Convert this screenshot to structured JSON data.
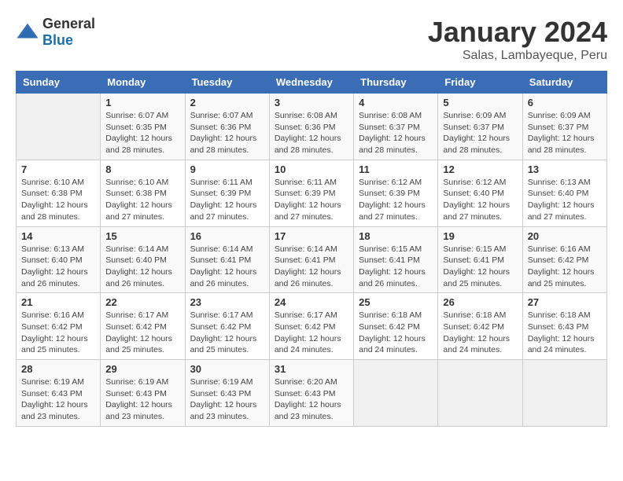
{
  "header": {
    "logo_general": "General",
    "logo_blue": "Blue",
    "month_year": "January 2024",
    "location": "Salas, Lambayeque, Peru"
  },
  "weekdays": [
    "Sunday",
    "Monday",
    "Tuesday",
    "Wednesday",
    "Thursday",
    "Friday",
    "Saturday"
  ],
  "weeks": [
    [
      {
        "day": "",
        "info": ""
      },
      {
        "day": "1",
        "info": "Sunrise: 6:07 AM\nSunset: 6:35 PM\nDaylight: 12 hours\nand 28 minutes."
      },
      {
        "day": "2",
        "info": "Sunrise: 6:07 AM\nSunset: 6:36 PM\nDaylight: 12 hours\nand 28 minutes."
      },
      {
        "day": "3",
        "info": "Sunrise: 6:08 AM\nSunset: 6:36 PM\nDaylight: 12 hours\nand 28 minutes."
      },
      {
        "day": "4",
        "info": "Sunrise: 6:08 AM\nSunset: 6:37 PM\nDaylight: 12 hours\nand 28 minutes."
      },
      {
        "day": "5",
        "info": "Sunrise: 6:09 AM\nSunset: 6:37 PM\nDaylight: 12 hours\nand 28 minutes."
      },
      {
        "day": "6",
        "info": "Sunrise: 6:09 AM\nSunset: 6:37 PM\nDaylight: 12 hours\nand 28 minutes."
      }
    ],
    [
      {
        "day": "7",
        "info": "Sunrise: 6:10 AM\nSunset: 6:38 PM\nDaylight: 12 hours\nand 28 minutes."
      },
      {
        "day": "8",
        "info": "Sunrise: 6:10 AM\nSunset: 6:38 PM\nDaylight: 12 hours\nand 27 minutes."
      },
      {
        "day": "9",
        "info": "Sunrise: 6:11 AM\nSunset: 6:39 PM\nDaylight: 12 hours\nand 27 minutes."
      },
      {
        "day": "10",
        "info": "Sunrise: 6:11 AM\nSunset: 6:39 PM\nDaylight: 12 hours\nand 27 minutes."
      },
      {
        "day": "11",
        "info": "Sunrise: 6:12 AM\nSunset: 6:39 PM\nDaylight: 12 hours\nand 27 minutes."
      },
      {
        "day": "12",
        "info": "Sunrise: 6:12 AM\nSunset: 6:40 PM\nDaylight: 12 hours\nand 27 minutes."
      },
      {
        "day": "13",
        "info": "Sunrise: 6:13 AM\nSunset: 6:40 PM\nDaylight: 12 hours\nand 27 minutes."
      }
    ],
    [
      {
        "day": "14",
        "info": "Sunrise: 6:13 AM\nSunset: 6:40 PM\nDaylight: 12 hours\nand 26 minutes."
      },
      {
        "day": "15",
        "info": "Sunrise: 6:14 AM\nSunset: 6:40 PM\nDaylight: 12 hours\nand 26 minutes."
      },
      {
        "day": "16",
        "info": "Sunrise: 6:14 AM\nSunset: 6:41 PM\nDaylight: 12 hours\nand 26 minutes."
      },
      {
        "day": "17",
        "info": "Sunrise: 6:14 AM\nSunset: 6:41 PM\nDaylight: 12 hours\nand 26 minutes."
      },
      {
        "day": "18",
        "info": "Sunrise: 6:15 AM\nSunset: 6:41 PM\nDaylight: 12 hours\nand 26 minutes."
      },
      {
        "day": "19",
        "info": "Sunrise: 6:15 AM\nSunset: 6:41 PM\nDaylight: 12 hours\nand 25 minutes."
      },
      {
        "day": "20",
        "info": "Sunrise: 6:16 AM\nSunset: 6:42 PM\nDaylight: 12 hours\nand 25 minutes."
      }
    ],
    [
      {
        "day": "21",
        "info": "Sunrise: 6:16 AM\nSunset: 6:42 PM\nDaylight: 12 hours\nand 25 minutes."
      },
      {
        "day": "22",
        "info": "Sunrise: 6:17 AM\nSunset: 6:42 PM\nDaylight: 12 hours\nand 25 minutes."
      },
      {
        "day": "23",
        "info": "Sunrise: 6:17 AM\nSunset: 6:42 PM\nDaylight: 12 hours\nand 25 minutes."
      },
      {
        "day": "24",
        "info": "Sunrise: 6:17 AM\nSunset: 6:42 PM\nDaylight: 12 hours\nand 24 minutes."
      },
      {
        "day": "25",
        "info": "Sunrise: 6:18 AM\nSunset: 6:42 PM\nDaylight: 12 hours\nand 24 minutes."
      },
      {
        "day": "26",
        "info": "Sunrise: 6:18 AM\nSunset: 6:42 PM\nDaylight: 12 hours\nand 24 minutes."
      },
      {
        "day": "27",
        "info": "Sunrise: 6:18 AM\nSunset: 6:43 PM\nDaylight: 12 hours\nand 24 minutes."
      }
    ],
    [
      {
        "day": "28",
        "info": "Sunrise: 6:19 AM\nSunset: 6:43 PM\nDaylight: 12 hours\nand 23 minutes."
      },
      {
        "day": "29",
        "info": "Sunrise: 6:19 AM\nSunset: 6:43 PM\nDaylight: 12 hours\nand 23 minutes."
      },
      {
        "day": "30",
        "info": "Sunrise: 6:19 AM\nSunset: 6:43 PM\nDaylight: 12 hours\nand 23 minutes."
      },
      {
        "day": "31",
        "info": "Sunrise: 6:20 AM\nSunset: 6:43 PM\nDaylight: 12 hours\nand 23 minutes."
      },
      {
        "day": "",
        "info": ""
      },
      {
        "day": "",
        "info": ""
      },
      {
        "day": "",
        "info": ""
      }
    ]
  ]
}
